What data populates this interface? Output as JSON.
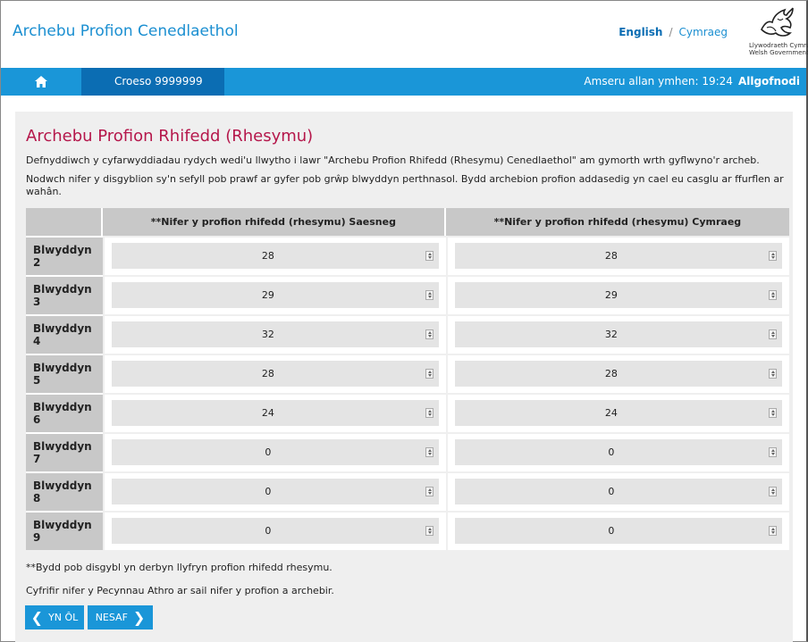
{
  "header": {
    "app_title": "Archebu Profion Cenedlaethol",
    "lang_english": "English",
    "lang_separator": "/",
    "lang_welsh": "Cymraeg",
    "logo_line1": "Llywodraeth Cymru",
    "logo_line2": "Welsh Government"
  },
  "navbar": {
    "home_icon": "home-icon",
    "welcome": "Croeso 9999999",
    "timeout_text": "Amseru allan ymhen: 19:24",
    "logout": "Allgofnodi"
  },
  "page": {
    "title": "Archebu Profion Rhifedd (Rhesymu)",
    "intro1": "Defnyddiwch y cyfarwyddiadau rydych wedi'u llwytho i lawr \"Archebu Profion Rhifedd (Rhesymu) Cenedlaethol\" am gymorth wrth gyflwyno'r archeb.",
    "intro2": "Nodwch nifer y disgyblion sy'n sefyll pob prawf ar gyfer pob grŵp blwyddyn perthnasol. Bydd archebion profion addasedig yn cael eu casglu ar ffurflen ar wahân."
  },
  "table": {
    "col_english": "**Nifer y profion rhifedd (rhesymu) Saesneg",
    "col_welsh": "**Nifer y profion rhifedd (rhesymu) Cymraeg",
    "rows": [
      {
        "label": "Blwyddyn 2",
        "english": "28",
        "welsh": "28"
      },
      {
        "label": "Blwyddyn 3",
        "english": "29",
        "welsh": "29"
      },
      {
        "label": "Blwyddyn 4",
        "english": "32",
        "welsh": "32"
      },
      {
        "label": "Blwyddyn 5",
        "english": "28",
        "welsh": "28"
      },
      {
        "label": "Blwyddyn 6",
        "english": "24",
        "welsh": "24"
      },
      {
        "label": "Blwyddyn 7",
        "english": "0",
        "welsh": "0"
      },
      {
        "label": "Blwyddyn 8",
        "english": "0",
        "welsh": "0"
      },
      {
        "label": "Blwyddyn 9",
        "english": "0",
        "welsh": "0"
      }
    ]
  },
  "footer": {
    "note1": "**Bydd pob disgybl yn derbyn llyfryn profion rhifedd rhesymu.",
    "note2": "Cyfrifir nifer y Pecynnau Athro ar sail nifer y profion a archebir.",
    "back_label": "YN ÔL",
    "next_label": "NESAF"
  },
  "colors": {
    "brand_blue": "#1a96d8",
    "dark_blue": "#0b6db3",
    "title_red": "#b5174b"
  }
}
